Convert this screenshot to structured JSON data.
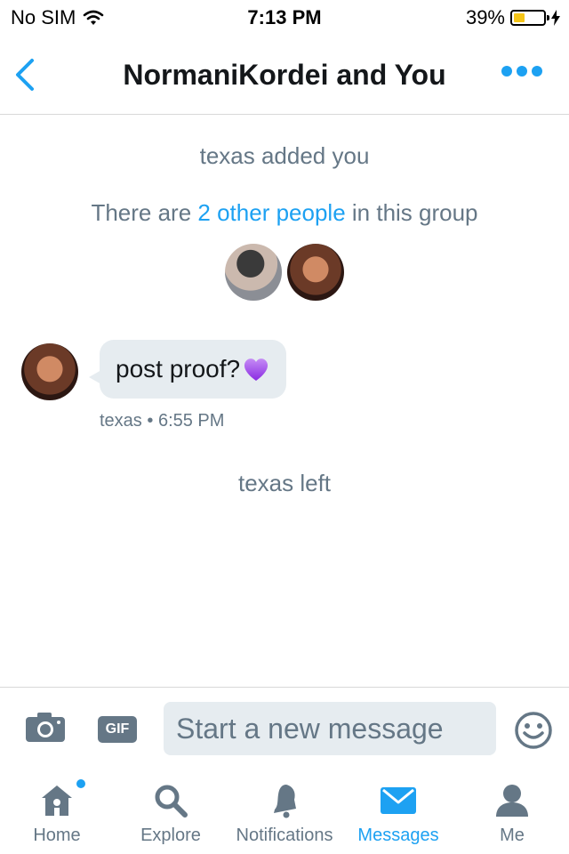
{
  "status_bar": {
    "carrier": "No SIM",
    "time": "7:13 PM",
    "battery": "39%",
    "battery_level": 0.39
  },
  "header": {
    "title": "NormaniKordei and You"
  },
  "conversation": {
    "added_text": "texas added you",
    "group_info": {
      "prefix": "There are ",
      "link": "2 other people",
      "suffix": " in this group"
    },
    "message": {
      "text": "post proof?",
      "emoji": "purple-heart",
      "sender": "texas",
      "separator": "•",
      "time": "6:55 PM"
    },
    "left_text": "texas left"
  },
  "composer": {
    "placeholder": "Start a new message",
    "gif_label": "GIF"
  },
  "tab_bar": {
    "tabs": [
      {
        "label": "Home",
        "icon": "home-icon"
      },
      {
        "label": "Explore",
        "icon": "search-icon"
      },
      {
        "label": "Notifications",
        "icon": "bell-icon"
      },
      {
        "label": "Messages",
        "icon": "envelope-icon"
      },
      {
        "label": "Me",
        "icon": "person-icon"
      }
    ],
    "active": "Messages",
    "accent": "#1da1f2"
  }
}
